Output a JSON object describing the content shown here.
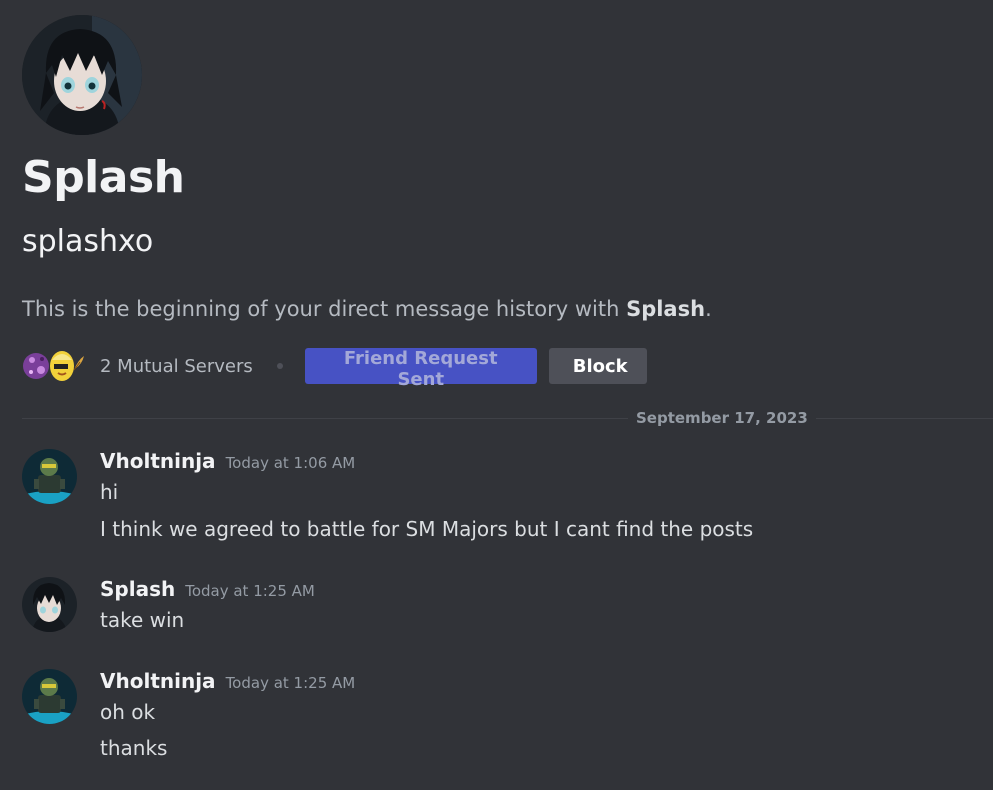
{
  "profile": {
    "display_name": "Splash",
    "username": "splashxo",
    "intro_prefix": "This is the beginning of your direct message history with ",
    "intro_name": "Splash",
    "intro_suffix": ".",
    "mutual_servers_label": "2 Mutual Servers",
    "friend_request_label": "Friend Request Sent",
    "block_label": "Block",
    "server_icons": [
      "server-icon-purple-creature",
      "server-icon-yellow-character"
    ]
  },
  "divider": {
    "date": "September 17, 2023"
  },
  "messages": [
    {
      "author": "Vholtninja",
      "timestamp": "Today at 1:06 AM",
      "lines": [
        "hi",
        "I think we agreed to battle for SM Majors but I cant find the posts"
      ]
    },
    {
      "author": "Splash",
      "timestamp": "Today at 1:25 AM",
      "lines": [
        "take win"
      ]
    },
    {
      "author": "Vholtninja",
      "timestamp": "Today at 1:25 AM",
      "lines": [
        "oh ok",
        "thanks"
      ]
    }
  ],
  "colors": {
    "background": "#313338",
    "pending_button": "#4752c4",
    "block_button": "#4e5058",
    "muted_text": "#949ba4"
  }
}
